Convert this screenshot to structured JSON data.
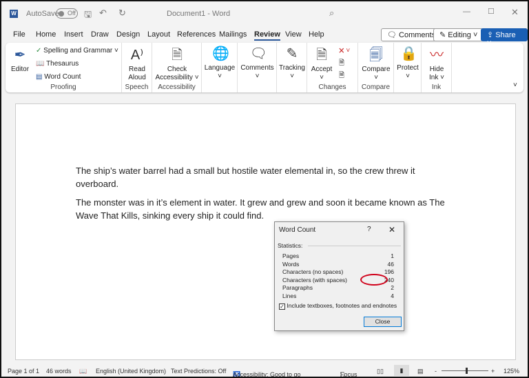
{
  "titlebar": {
    "autosave": "AutoSave",
    "toggle": "Off",
    "doc_title": "Document1 - Word"
  },
  "tabs": [
    "File",
    "Home",
    "Insert",
    "Draw",
    "Design",
    "Layout",
    "References",
    "Mailings",
    "Review",
    "View",
    "Help"
  ],
  "active_tab": "Review",
  "right_buttons": {
    "comments": "Comments",
    "editing": "Editing",
    "share": "Share"
  },
  "ribbon": {
    "proofing": {
      "editor": "Editor",
      "spelling": "Spelling and Grammar",
      "thesaurus": "Thesaurus",
      "word_count": "Word Count",
      "label": "Proofing"
    },
    "speech": {
      "read": "Read",
      "aloud": "Aloud",
      "label": "Speech"
    },
    "accessibility": {
      "check": "Check",
      "acc": "Accessibility",
      "label": "Accessibility"
    },
    "language": "Language",
    "comments": "Comments",
    "tracking": "Tracking",
    "changes": {
      "accept": "Accept",
      "label": "Changes"
    },
    "compare": {
      "btn": "Compare",
      "label": "Compare"
    },
    "protect": "Protect",
    "ink": {
      "hide": "Hide",
      "ink": "Ink",
      "label": "Ink"
    }
  },
  "document": {
    "paragraphs": [
      "The ship’s water barrel had a small but hostile water elemental in, so the crew threw it overboard.",
      "The monster was in it’s element in water. It grew and grew and soon it became known as The Wave That Kills, sinking every ship it could find."
    ]
  },
  "dialog": {
    "title": "Word Count",
    "help": "?",
    "section": "Statistics:",
    "stats": [
      {
        "label": "Pages",
        "value": "1"
      },
      {
        "label": "Words",
        "value": "46"
      },
      {
        "label": "Characters (no spaces)",
        "value": "196"
      },
      {
        "label": "Characters (with spaces)",
        "value": "240"
      },
      {
        "label": "Paragraphs",
        "value": "2"
      },
      {
        "label": "Lines",
        "value": "4"
      }
    ],
    "checkbox": "Include textboxes, footnotes and endnotes",
    "checked": true,
    "close": "Close",
    "highlight_color": "#d0021b"
  },
  "status": {
    "page": "Page 1 of 1",
    "words": "46 words",
    "language": "English (United Kingdom)",
    "predictions": "Text Predictions: Off",
    "accessibility": "Accessibility: Good to go",
    "focus": "Focus",
    "zoom": "125%",
    "zoom_minus": "-",
    "zoom_plus": "+"
  },
  "colors": {
    "accent": "#2b579a",
    "share": "#1a5fb4"
  }
}
